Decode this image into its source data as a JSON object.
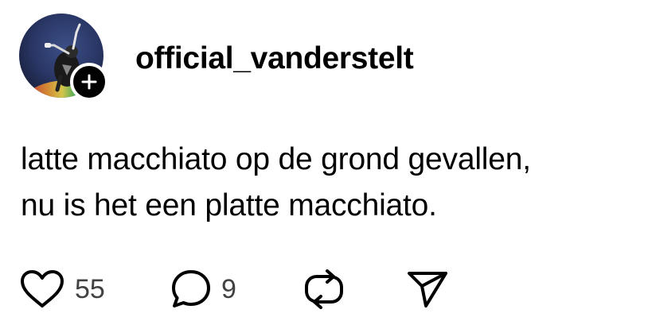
{
  "post": {
    "username": "official_vanderstelt",
    "text_lines": [
      "latte macchiato op de grond gevallen,",
      "nu is het een platte macchiato."
    ]
  },
  "actions": {
    "likes": "55",
    "replies": "9"
  },
  "icons": {
    "like": "heart-icon",
    "reply": "speech-bubble-icon",
    "repost": "repost-icon",
    "share": "send-icon",
    "follow": "plus-icon"
  },
  "colors": {
    "text": "#000000",
    "count": "#424242",
    "follow_button": "#000000"
  }
}
